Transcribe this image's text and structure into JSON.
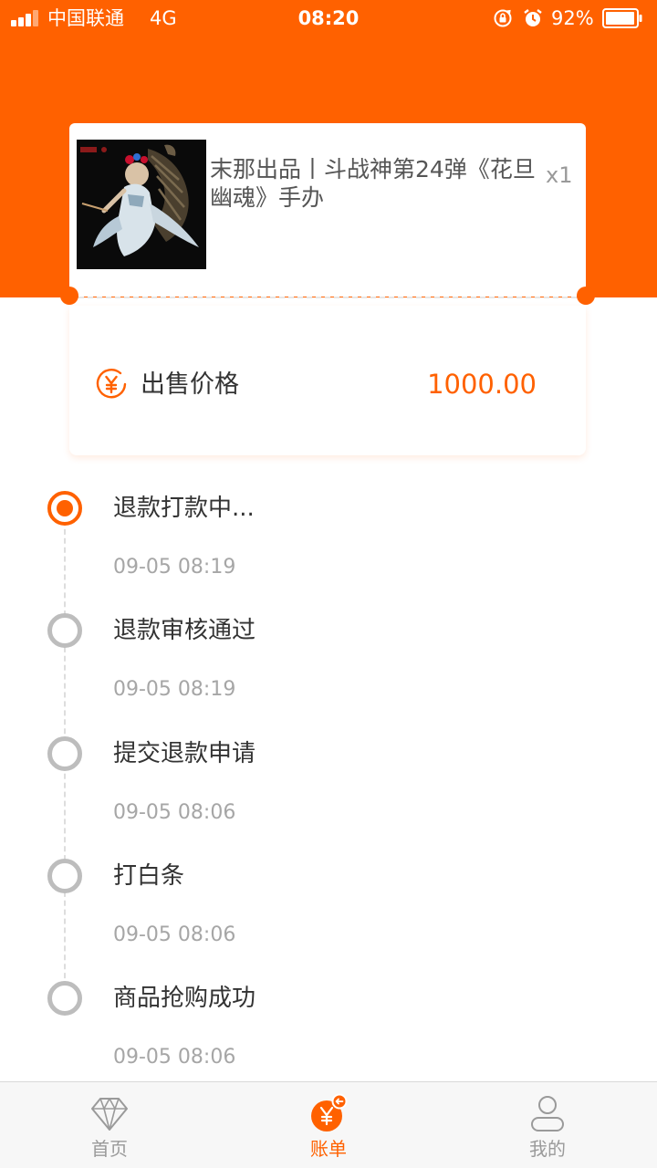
{
  "status_bar": {
    "carrier": "中国联通",
    "network": "4G",
    "time": "08:20",
    "battery": "92%"
  },
  "product": {
    "title": "末那出品丨斗战神第24弹《花旦幽魂》手办",
    "quantity": "x1"
  },
  "price": {
    "label": "出售价格",
    "value": "1000.00"
  },
  "timeline": [
    {
      "title": "退款打款中...",
      "time": "09-05 08:19",
      "active": true
    },
    {
      "title": "退款审核通过",
      "time": "09-05 08:19",
      "active": false
    },
    {
      "title": "提交退款申请",
      "time": "09-05 08:06",
      "active": false
    },
    {
      "title": "打白条",
      "time": "09-05 08:06",
      "active": false
    },
    {
      "title": "商品抢购成功",
      "time": "09-05 08:06",
      "active": false
    }
  ],
  "tabs": {
    "home": "首页",
    "bill": "账单",
    "mine": "我的",
    "selected": "bill"
  },
  "colors": {
    "accent": "#ff6100",
    "inactive_dot": "#bdbdbd",
    "muted_text": "#a6a6a6"
  },
  "icons": {
    "price": "yen-circle-icon",
    "home": "diamond-icon",
    "bill": "yen-bill-icon",
    "mine": "person-icon"
  }
}
